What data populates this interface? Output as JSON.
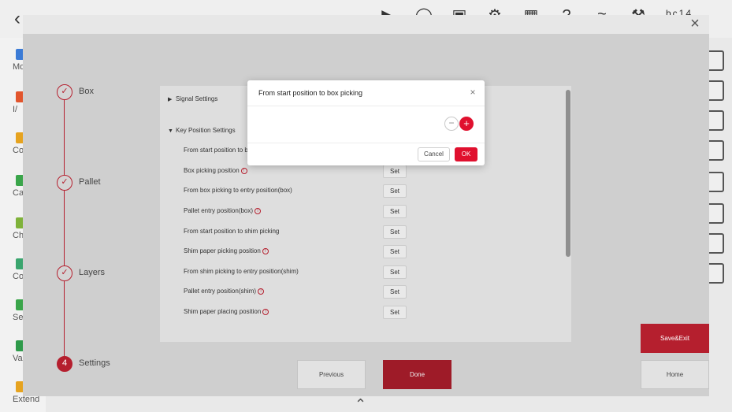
{
  "topbar": {
    "user": "bc14",
    "icons": [
      "play-icon",
      "speed-icon",
      "display-icon",
      "gear-icon",
      "calendar-icon",
      "help-icon",
      "wifi-icon",
      "robot-arm-icon",
      "more-icon"
    ]
  },
  "leftnav": {
    "items": [
      {
        "label": "Mo",
        "color": "#3b7bd6"
      },
      {
        "label": "I/",
        "color": "#e2552d"
      },
      {
        "label": "Con",
        "color": "#e6a31f"
      },
      {
        "label": "Calc",
        "color": "#3aa54a"
      },
      {
        "label": "Char",
        "color": "#7fb23a"
      },
      {
        "label": "Co",
        "color": "#3aa56e"
      },
      {
        "label": "Se",
        "color": "#3aa54a"
      },
      {
        "label": "Vari",
        "color": "#2e9a4a"
      },
      {
        "label": "Extend",
        "color": "#e6a31f"
      }
    ]
  },
  "stepper": {
    "steps": [
      {
        "label": "Box",
        "state": "done",
        "mark": "✓"
      },
      {
        "label": "Pallet",
        "state": "done",
        "mark": "✓"
      },
      {
        "label": "Layers",
        "state": "done",
        "mark": "✓"
      },
      {
        "label": "Settings",
        "state": "active",
        "mark": "4"
      }
    ]
  },
  "panel": {
    "signal_settings": "Signal Settings",
    "key_position_settings": "Key Position Settings",
    "rows": [
      {
        "label": "From start position to b",
        "info": false,
        "set": ""
      },
      {
        "label": "Box picking position",
        "info": true,
        "set": "Set"
      },
      {
        "label": "From box picking to entry position(box)",
        "info": false,
        "set": "Set"
      },
      {
        "label": "Pallet entry position(box)",
        "info": true,
        "set": "Set"
      },
      {
        "label": "From start position to shim picking",
        "info": false,
        "set": "Set"
      },
      {
        "label": "Shim paper picking position",
        "info": true,
        "set": "Set"
      },
      {
        "label": "From shim picking to entry position(shim)",
        "info": false,
        "set": "Set"
      },
      {
        "label": "Pallet entry position(shim)",
        "info": true,
        "set": "Set"
      },
      {
        "label": "Shim paper placing position",
        "info": true,
        "set": "Set"
      }
    ]
  },
  "buttons": {
    "previous": "Previous",
    "done": "Done",
    "save_exit": "Save&Exit",
    "home": "Home"
  },
  "dialog": {
    "title": "From start position to box picking",
    "close": "×",
    "minus": "−",
    "plus": "+",
    "cancel": "Cancel",
    "ok": "OK"
  },
  "colors": {
    "brand_red": "#e0102e",
    "dark_red": "#b51f2e"
  }
}
